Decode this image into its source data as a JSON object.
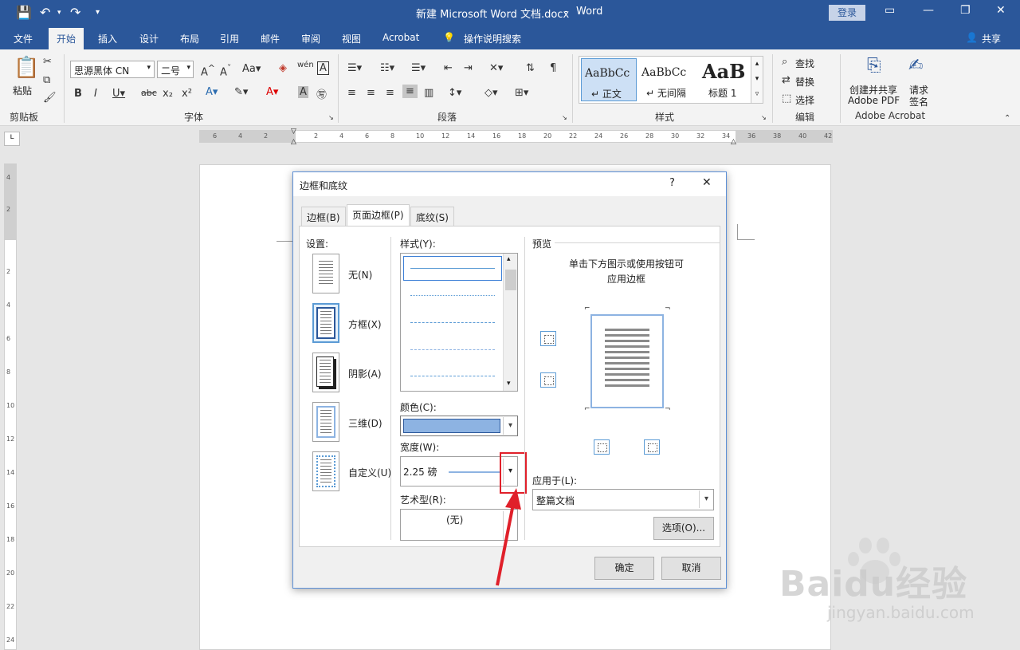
{
  "titlebar": {
    "doc_title": "新建 Microsoft Word 文档.docx",
    "app": "Word",
    "login": "登录"
  },
  "tabs": [
    "文件",
    "开始",
    "插入",
    "设计",
    "布局",
    "引用",
    "邮件",
    "审阅",
    "视图",
    "Acrobat",
    "操作说明搜索"
  ],
  "share": "共享",
  "ribbon": {
    "paste": "粘贴",
    "font_name": "思源黑体 CN",
    "font_size": "二号",
    "groups": {
      "clipboard": "剪贴板",
      "font": "字体",
      "paragraph": "段落",
      "styles": "样式",
      "editing": "编辑",
      "acrobat": "Adobe Acrobat"
    },
    "styles": [
      {
        "preview": "AaBbCc",
        "label": "↵ 正文"
      },
      {
        "preview": "AaBbCc",
        "label": "↵ 无间隔"
      },
      {
        "preview": "AaB",
        "label": "标题 1"
      }
    ],
    "find": "查找",
    "replace": "替换",
    "select": "选择",
    "create_pdf_1": "创建并共享",
    "create_pdf_2": "Adobe PDF",
    "request_sign_1": "请求",
    "request_sign_2": "签名"
  },
  "ruler": {
    "h_ticks": [
      "6",
      "4",
      "2",
      "2",
      "4",
      "6",
      "8",
      "10",
      "12",
      "14",
      "16",
      "18",
      "20",
      "22",
      "24",
      "26",
      "28",
      "30",
      "32",
      "34",
      "36",
      "38",
      "40",
      "42"
    ],
    "v_ticks": [
      "4",
      "2",
      "2",
      "4",
      "6",
      "8",
      "10",
      "12",
      "14",
      "16",
      "18",
      "20",
      "22",
      "24"
    ]
  },
  "dialog": {
    "title": "边框和底纹",
    "help": "?",
    "close": "✕",
    "tabs": [
      "边框(B)",
      "页面边框(P)",
      "底纹(S)"
    ],
    "settings_label": "设置:",
    "settings": [
      "无(N)",
      "方框(X)",
      "阴影(A)",
      "三维(D)",
      "自定义(U)"
    ],
    "style_label": "样式(Y):",
    "color_label": "颜色(C):",
    "color_value": "#8db3e2",
    "width_label": "宽度(W):",
    "width_value": "2.25 磅",
    "art_label": "艺术型(R):",
    "art_value": "(无)",
    "preview_label": "预览",
    "preview_hint_1": "单击下方图示或使用按钮可",
    "preview_hint_2": "应用边框",
    "apply_label": "应用于(L):",
    "apply_value": "整篇文档",
    "options": "选项(O)...",
    "ok": "确定",
    "cancel": "取消"
  },
  "watermark": {
    "brand": "Baidu经验",
    "url": "jingyan.baidu.com"
  },
  "colors": {
    "accent": "#2b579a",
    "highlight_red": "#e0202a",
    "border_blue": "#5b9bd5"
  }
}
